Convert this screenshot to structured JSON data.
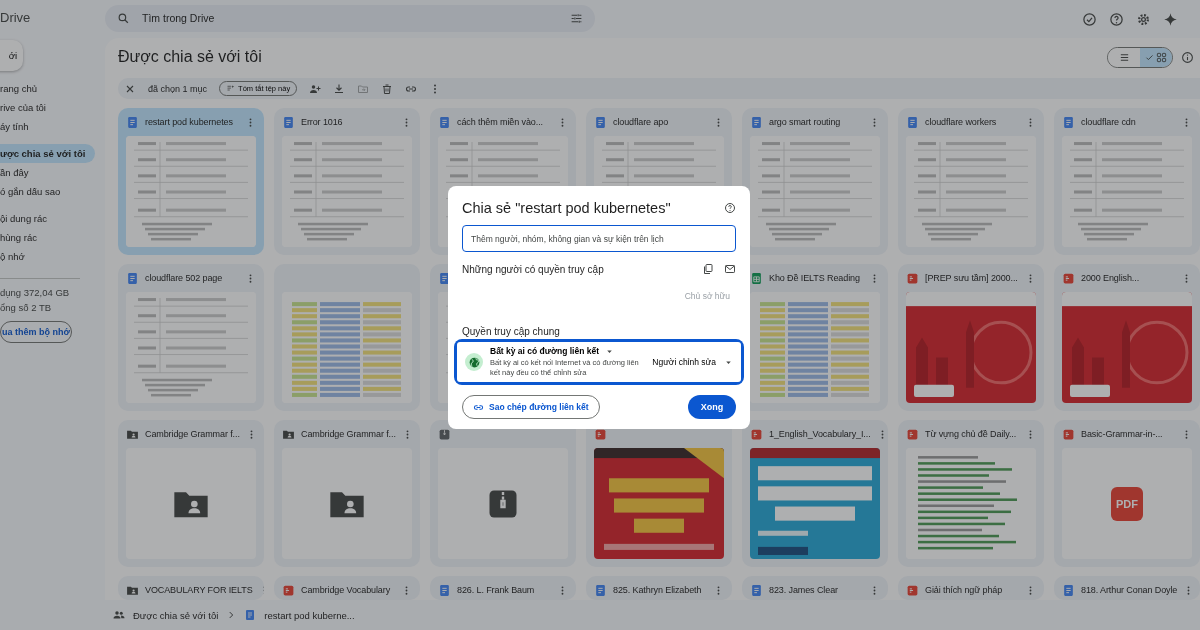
{
  "sidebar": {
    "logo": "Drive",
    "new_button": "ới",
    "sections": [
      {
        "items": [
          {
            "label": "rang chủ",
            "selected": false
          },
          {
            "label": "rive của tôi",
            "selected": false
          },
          {
            "label": "áy tính",
            "selected": false
          }
        ]
      },
      {
        "items": [
          {
            "label": "ược chia sẻ với tôi",
            "selected": true
          },
          {
            "label": "ần đây",
            "selected": false
          },
          {
            "label": "ó gắn dấu sao",
            "selected": false
          }
        ]
      },
      {
        "items": [
          {
            "label": "ội dung rác",
            "selected": false
          },
          {
            "label": "hùng rác",
            "selected": false
          },
          {
            "label": "ộ nhớ",
            "selected": false
          }
        ]
      }
    ],
    "storage": {
      "used": "dụng 372,04 GB",
      "total": "ổng số 2 TB",
      "button": "ua thêm bộ nhớ"
    }
  },
  "search": {
    "placeholder": "Tìm trong Drive"
  },
  "page_title": "Được chia sẻ với tôi",
  "view_toggle": [
    {
      "kind": "list",
      "selected": false
    },
    {
      "kind": "grid",
      "selected": true
    }
  ],
  "selection_bar": {
    "count": "đã chọn 1 mục",
    "summarize_button": "Tóm tắt tệp này"
  },
  "files": [
    {
      "title": "restart pod kubernetes",
      "kind": "doc",
      "preview": {
        "kind": "doc"
      },
      "selected": true
    },
    {
      "title": "Error 1016",
      "kind": "doc",
      "preview": {
        "kind": "doc"
      },
      "selected": false
    },
    {
      "title": "cách thêm miền vào...",
      "kind": "doc",
      "preview": {
        "kind": "doc"
      },
      "selected": false
    },
    {
      "title": "cloudflare apo",
      "kind": "doc",
      "preview": {
        "kind": "doc"
      },
      "selected": false
    },
    {
      "title": "argo smart routing",
      "kind": "doc",
      "preview": {
        "kind": "doc"
      },
      "selected": false
    },
    {
      "title": "cloudflare workers",
      "kind": "doc",
      "preview": {
        "kind": "doc"
      },
      "selected": false
    },
    {
      "title": "cloudflare cdn",
      "kind": "doc",
      "preview": {
        "kind": "doc"
      },
      "selected": false
    },
    {
      "title": "cloudflare 502 page",
      "kind": "doc",
      "preview": {
        "kind": "doc"
      },
      "selected": false
    },
    {
      "preview": {
        "kind": "sheet"
      },
      "selected": false
    },
    {
      "kind": "doc",
      "preview": {
        "kind": "doc"
      },
      "selected": false
    },
    {
      "title": "Kho Đề IELTS Reading",
      "kind": "sheet",
      "preview": {
        "kind": "sheet"
      },
      "selected": false
    },
    {
      "title": "[PREP sưu tầm] 2000...",
      "kind": "pdf",
      "preview": {
        "kind": "redcover"
      },
      "selected": false
    },
    {
      "title": "2000 English...",
      "kind": "pdf",
      "preview": {
        "kind": "redcover"
      },
      "selected": false
    },
    {
      "title": "Cambridge Grammar f...",
      "kind": "folder",
      "preview": {
        "kind": "folder"
      },
      "selected": false
    },
    {
      "title": "Cambridge Grammar f...",
      "kind": "folder",
      "preview": {
        "kind": "folder"
      },
      "selected": false
    },
    {
      "kind": "zip",
      "preview": {
        "kind": "zip"
      },
      "selected": false
    },
    {
      "kind": "pdf",
      "preview": {
        "kind": "grammar"
      },
      "selected": false
    },
    {
      "title": "1_English_Vocabulary_I...",
      "kind": "pdf",
      "preview": {
        "kind": "vocab"
      },
      "selected": false
    },
    {
      "title": "Từ vựng chủ đề Daily...",
      "kind": "pdf",
      "preview": {
        "kind": "list"
      },
      "selected": false
    },
    {
      "title": "Basic-Grammar-in-...",
      "kind": "pdf",
      "preview": {
        "kind": "bigpdf",
        "label": "PDF"
      },
      "selected": false
    },
    {
      "title": "VOCABULARY FOR IELTS",
      "kind": "folder",
      "selected": false
    },
    {
      "title": "Cambridge Vocabulary",
      "kind": "pdf",
      "selected": false
    },
    {
      "title": "826. L. Frank Baum",
      "kind": "doc",
      "selected": false
    },
    {
      "title": "825. Kathryn Elizabeth",
      "kind": "doc",
      "selected": false
    },
    {
      "title": "823. James Clear",
      "kind": "doc",
      "selected": false
    },
    {
      "title": "Giải thích ngữ pháp",
      "kind": "pdf",
      "selected": false
    },
    {
      "title": "818. Arthur Conan Doyle",
      "kind": "doc",
      "selected": false
    }
  ],
  "breadcrumb": [
    {
      "label": "Được chia sẻ với tôi",
      "kind": "shared"
    },
    {
      "label": "restart pod kuberne...",
      "kind": "doc"
    }
  ],
  "dialog": {
    "title": "Chia sẻ \"restart pod kubernetes\"",
    "input_placeholder": "Thêm người, nhóm, không gian và sự kiện trên lịch",
    "people_heading": "Những người có quyền truy cập",
    "owner_role": "Chủ sở hữu",
    "general_heading": "Quyền truy cập chung",
    "access_scope": "Bất kỳ ai có đường liên kết",
    "access_description": "Bất kỳ ai có kết nối Internet và có đường liên kết này đều có thể chỉnh sửa",
    "access_role": "Người chỉnh sửa",
    "highlighted": true,
    "copy_link_button": "Sao chép đường liên kết",
    "done_button": "Xong"
  }
}
